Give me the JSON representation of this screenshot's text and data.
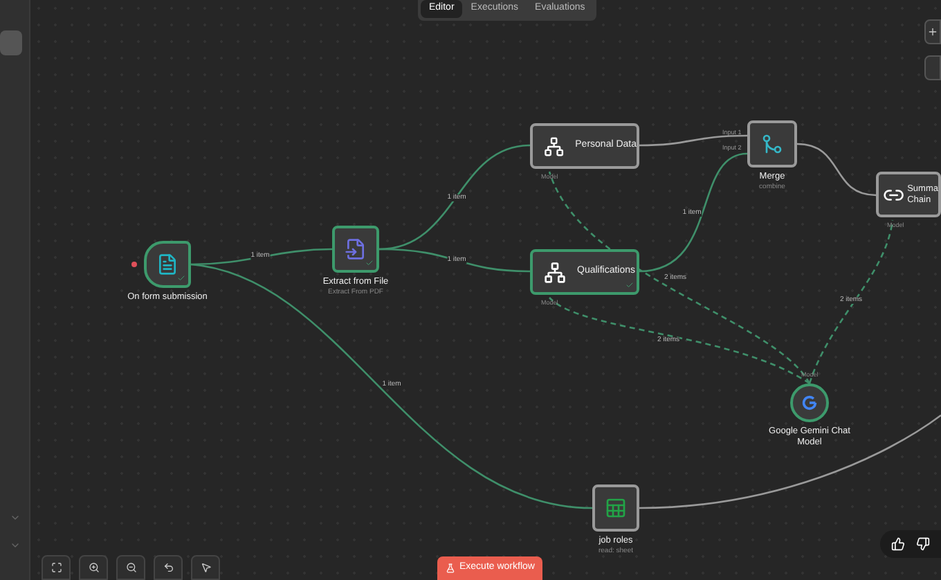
{
  "tabs": [
    {
      "label": "Editor",
      "selected": true
    },
    {
      "label": "Executions",
      "selected": false
    },
    {
      "label": "Evaluations",
      "selected": false
    }
  ],
  "nodes": [
    {
      "kind": "trigger",
      "title": [
        "On form submission"
      ],
      "executed": true
    },
    {
      "kind": "file",
      "title": [
        "Extract from File"
      ],
      "subtitle": "Extract From PDF",
      "executed": true
    },
    {
      "kind": "wide",
      "title": [
        "Personal Data"
      ],
      "port_label": "Model",
      "executed": false
    },
    {
      "kind": "wide",
      "title": [
        "Qualifications"
      ],
      "port_label": "Model",
      "executed": true
    },
    {
      "kind": "merge",
      "title": [
        "Merge"
      ],
      "subtitle": "combine",
      "inputs": [
        "Input 1",
        "Input 2"
      ],
      "executed": false
    },
    {
      "kind": "chain",
      "title": [
        "Summa",
        "Chain"
      ],
      "port_label": "Model",
      "executed": false
    },
    {
      "kind": "model",
      "title": [
        "Google Gemini Chat",
        "Model"
      ],
      "port_label": "Model",
      "executed": true
    },
    {
      "kind": "sheet",
      "title": [
        "job roles"
      ],
      "subtitle": "read: sheet",
      "executed": false
    }
  ],
  "edges": [
    {
      "kind": "main",
      "executed": true,
      "label": "1 item"
    },
    {
      "kind": "main",
      "executed": true,
      "label": "1 item"
    },
    {
      "kind": "main",
      "executed": true,
      "label": "1 item"
    },
    {
      "kind": "main",
      "executed": false
    },
    {
      "kind": "main",
      "executed": true,
      "label": "1 item"
    },
    {
      "kind": "main",
      "executed": false
    },
    {
      "kind": "main",
      "executed": true,
      "label": "1 item"
    },
    {
      "kind": "main",
      "executed": false
    },
    {
      "kind": "ai",
      "executed": true,
      "label": "2 items"
    },
    {
      "kind": "ai",
      "executed": true,
      "label": "2 items"
    },
    {
      "kind": "ai",
      "executed": true,
      "label": "2 items"
    }
  ],
  "execute_button": "Execute workflow"
}
